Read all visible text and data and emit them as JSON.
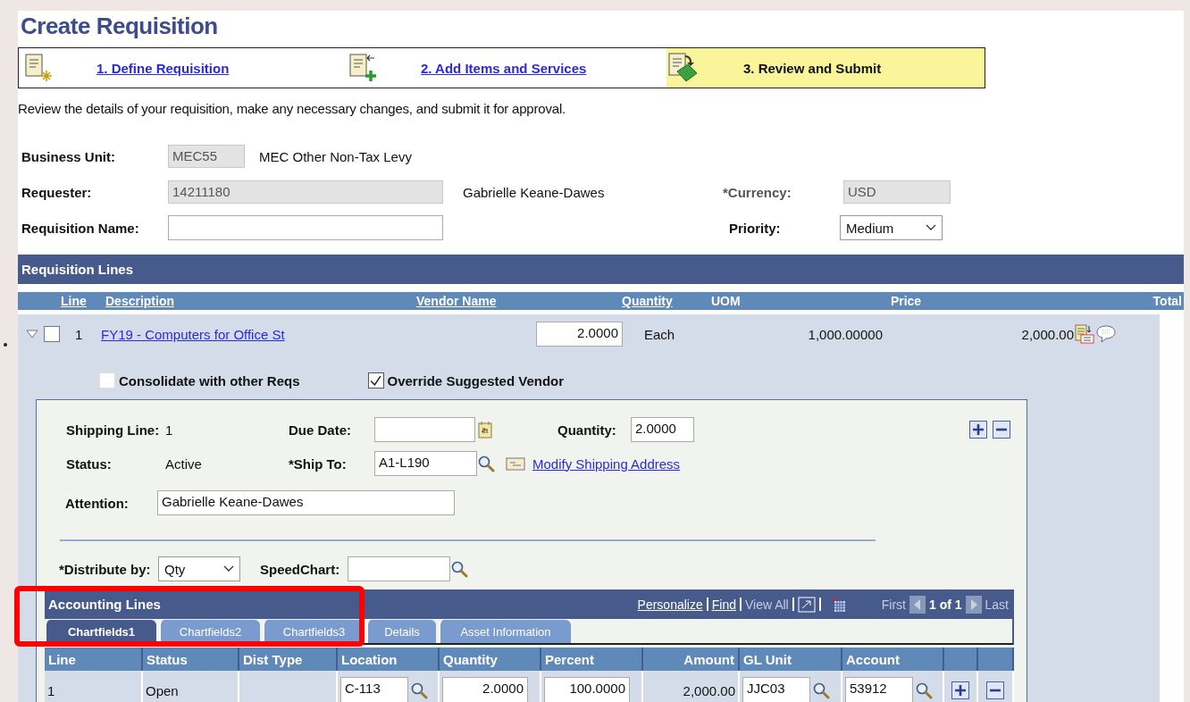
{
  "title": "Create Requisition",
  "steps": [
    {
      "label": "1. Define Requisition",
      "selected": false
    },
    {
      "label": "2. Add Items and Services",
      "selected": false
    },
    {
      "label": "3. Review and Submit",
      "selected": true
    }
  ],
  "instructions": "Review the details of your requisition, make any necessary changes, and submit it for approval.",
  "header": {
    "business_unit": {
      "label": "Business Unit:",
      "value": "MEC55",
      "description": "MEC Other Non-Tax Levy"
    },
    "requester": {
      "label": "Requester:",
      "value": "14211180",
      "name": "Gabrielle Keane-Dawes"
    },
    "currency": {
      "label": "*Currency:",
      "value": "USD"
    },
    "requisition_name": {
      "label": "Requisition Name:"
    },
    "priority": {
      "label": "Priority:",
      "value": "Medium"
    }
  },
  "requisition_lines": {
    "title": "Requisition Lines",
    "columns": [
      {
        "label": "Line",
        "sortable": true
      },
      {
        "label": "Description",
        "sortable": true
      },
      {
        "label": "Vendor Name",
        "sortable": true
      },
      {
        "label": "Quantity",
        "sortable": true
      },
      {
        "label": "UOM",
        "sortable": false
      },
      {
        "label": "Price",
        "sortable": false
      },
      {
        "label": "Total",
        "sortable": false
      }
    ],
    "line": {
      "expanded": true,
      "checked": false,
      "number": "1",
      "description": "FY19 - Computers for Office St",
      "quantity": "2.0000",
      "uom": "Each",
      "price": "1,000.00000",
      "total": "2,000.00",
      "options": [
        {
          "label": "Consolidate with other Reqs",
          "checked": false
        },
        {
          "label": "Override Suggested Vendor",
          "checked": true
        }
      ]
    }
  },
  "shipping": {
    "shipping_line": {
      "label": "Shipping Line:",
      "value": "1"
    },
    "due_date": {
      "label": "Due Date:"
    },
    "quantity": {
      "label": "Quantity:",
      "value": "2.0000"
    },
    "status": {
      "label": "Status:",
      "value": "Active"
    },
    "ship_to": {
      "label": "*Ship To:",
      "value": "A1-L190"
    },
    "modify_address": "Modify Shipping Address",
    "attention": {
      "label": "Attention:",
      "value": "Gabrielle Keane-Dawes"
    },
    "distribute_by": {
      "label": "*Distribute by:",
      "value": "Qty"
    },
    "speedchart": {
      "label": "SpeedChart:"
    }
  },
  "accounting": {
    "title": "Accounting Lines",
    "links": [
      {
        "label": "Personalize",
        "disabled": false
      },
      {
        "label": "Find",
        "disabled": false
      },
      {
        "label": "View All",
        "disabled": true
      }
    ],
    "pager": {
      "first": {
        "label": "First",
        "disabled": true
      },
      "count": "1 of 1",
      "last": {
        "label": "Last",
        "disabled": true
      }
    },
    "tabs": [
      {
        "label": "Chartfields1",
        "selected": true
      },
      {
        "label": "Chartfields2",
        "selected": false
      },
      {
        "label": "Chartfields3",
        "selected": false
      },
      {
        "label": "Details",
        "selected": false
      },
      {
        "label": "Asset Information",
        "selected": false
      }
    ],
    "columns": [
      {
        "label": "Line",
        "kind": "text"
      },
      {
        "label": "Status",
        "kind": "text"
      },
      {
        "label": "Dist Type",
        "kind": "text"
      },
      {
        "label": "Location",
        "kind": "text"
      },
      {
        "label": "Quantity",
        "kind": "text"
      },
      {
        "label": "Percent",
        "kind": "text"
      },
      {
        "label": "Amount",
        "kind": "number"
      },
      {
        "label": "GL Unit",
        "kind": "text"
      },
      {
        "label": "Account",
        "kind": "text"
      }
    ],
    "row": [
      {
        "kind": "text",
        "value": "1"
      },
      {
        "kind": "text",
        "value": "Open"
      },
      {
        "kind": "empty"
      },
      {
        "kind": "lookup",
        "value": "C-113"
      },
      {
        "kind": "input",
        "value": "2.0000"
      },
      {
        "kind": "input",
        "value": "100.0000"
      },
      {
        "kind": "amount",
        "value": "2,000.00"
      },
      {
        "kind": "lookup",
        "value": "JJC03"
      },
      {
        "kind": "lookup",
        "value": "53912"
      }
    ]
  }
}
